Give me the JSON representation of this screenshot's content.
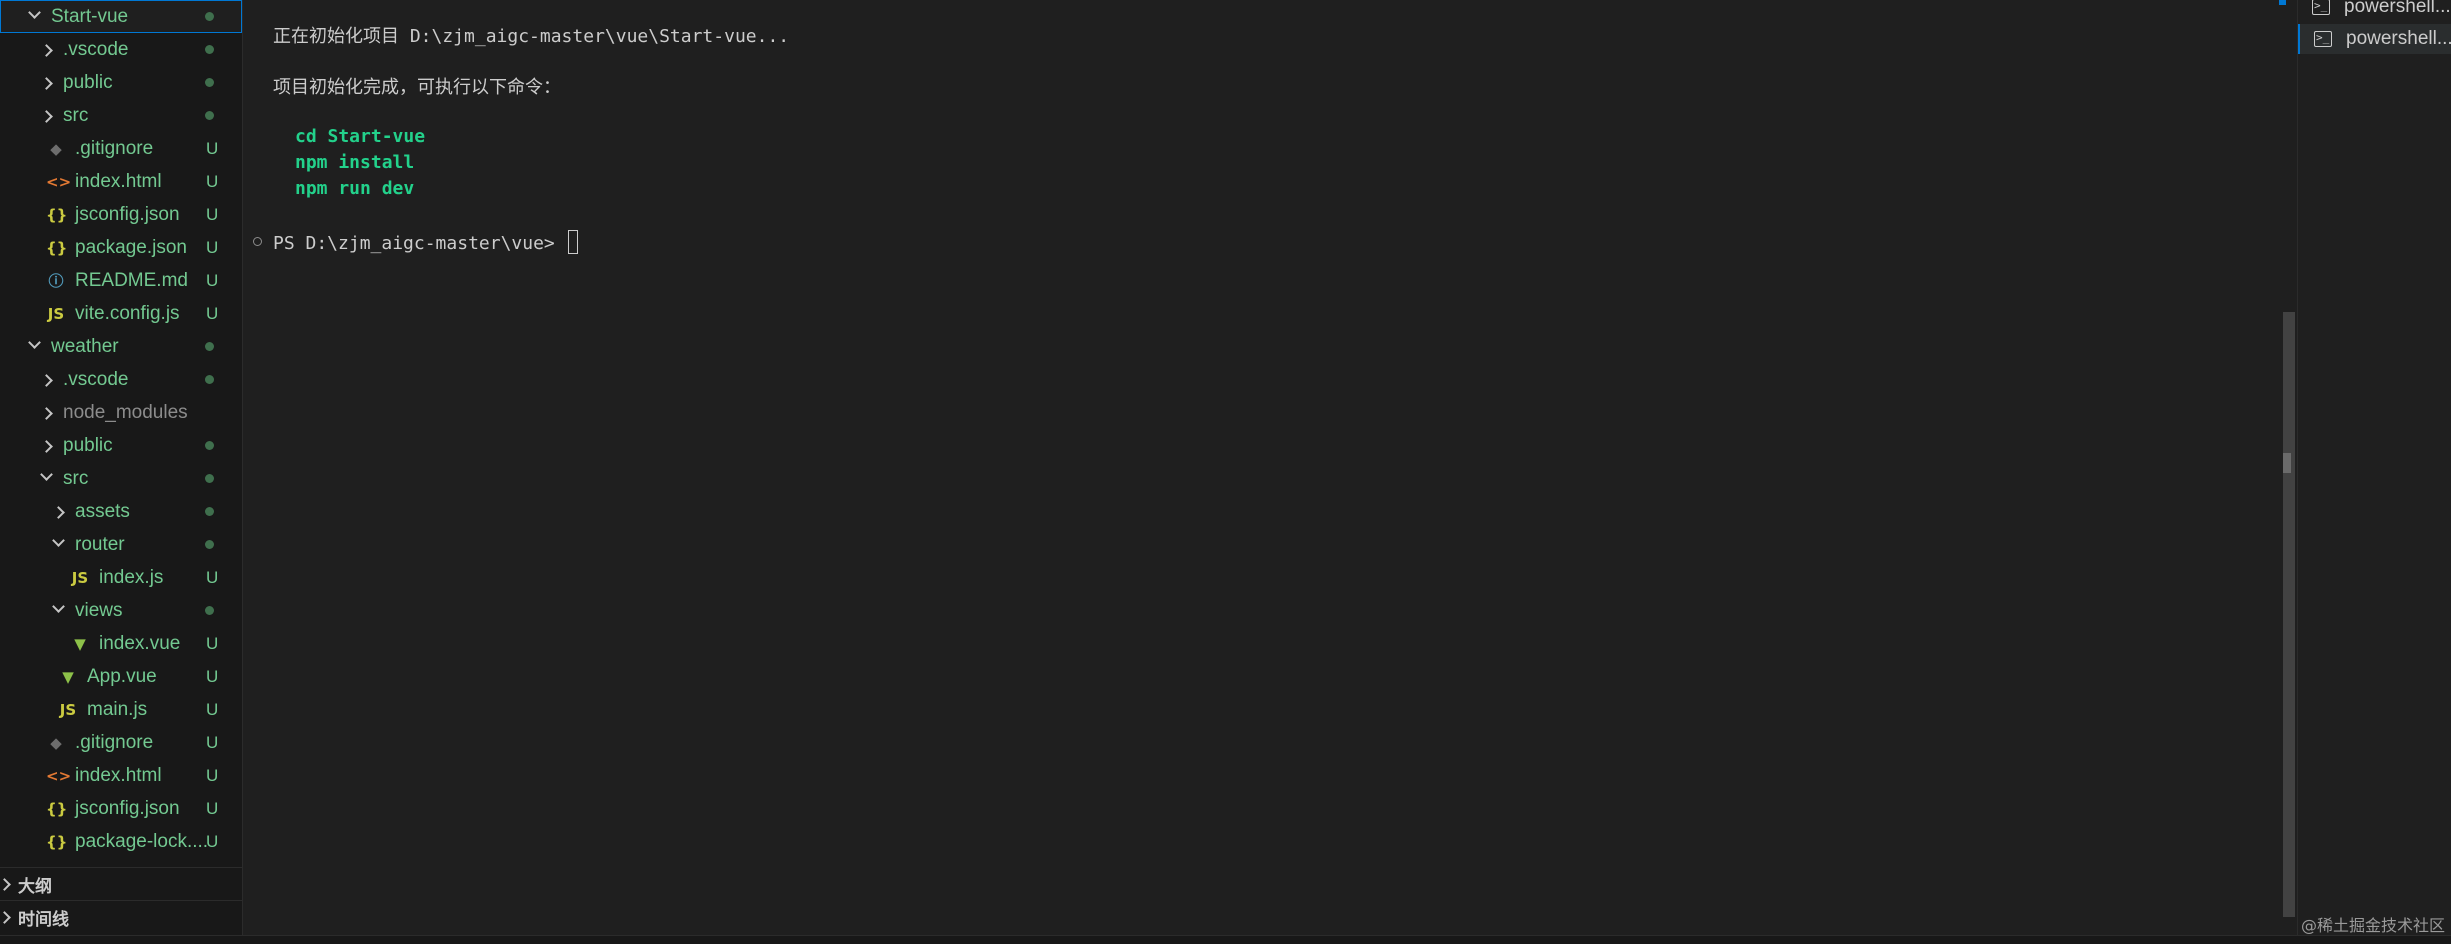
{
  "explorer": {
    "items": [
      {
        "label": "Start-vue",
        "kind": "folder-open",
        "depth": 0,
        "status": "dot",
        "color": "green",
        "selected": true
      },
      {
        "label": ".vscode",
        "kind": "folder-closed",
        "depth": 1,
        "status": "dot",
        "color": "green"
      },
      {
        "label": "public",
        "kind": "folder-closed",
        "depth": 1,
        "status": "dot",
        "color": "green"
      },
      {
        "label": "src",
        "kind": "folder-closed",
        "depth": 1,
        "status": "dot",
        "color": "green"
      },
      {
        "label": ".gitignore",
        "kind": "file",
        "icon": "git",
        "depth": 1,
        "status": "U",
        "color": "green"
      },
      {
        "label": "index.html",
        "kind": "file",
        "icon": "html",
        "depth": 1,
        "status": "U",
        "color": "green"
      },
      {
        "label": "jsconfig.json",
        "kind": "file",
        "icon": "json",
        "depth": 1,
        "status": "U",
        "color": "green"
      },
      {
        "label": "package.json",
        "kind": "file",
        "icon": "json",
        "depth": 1,
        "status": "U",
        "color": "green"
      },
      {
        "label": "README.md",
        "kind": "file",
        "icon": "info",
        "depth": 1,
        "status": "U",
        "color": "green"
      },
      {
        "label": "vite.config.js",
        "kind": "file",
        "icon": "js",
        "depth": 1,
        "status": "U",
        "color": "green"
      },
      {
        "label": "weather",
        "kind": "folder-open",
        "depth": 0,
        "status": "dot",
        "color": "green"
      },
      {
        "label": ".vscode",
        "kind": "folder-closed",
        "depth": 1,
        "status": "dot",
        "color": "green"
      },
      {
        "label": "node_modules",
        "kind": "folder-closed",
        "depth": 1,
        "status": "",
        "color": "gray"
      },
      {
        "label": "public",
        "kind": "folder-closed",
        "depth": 1,
        "status": "dot",
        "color": "green"
      },
      {
        "label": "src",
        "kind": "folder-open",
        "depth": 1,
        "status": "dot",
        "color": "green"
      },
      {
        "label": "assets",
        "kind": "folder-closed",
        "depth": 2,
        "status": "dot",
        "color": "green"
      },
      {
        "label": "router",
        "kind": "folder-open",
        "depth": 2,
        "status": "dot",
        "color": "green"
      },
      {
        "label": "index.js",
        "kind": "file",
        "icon": "js",
        "depth": 3,
        "status": "U",
        "color": "green"
      },
      {
        "label": "views",
        "kind": "folder-open",
        "depth": 2,
        "status": "dot",
        "color": "green"
      },
      {
        "label": "index.vue",
        "kind": "file",
        "icon": "vue",
        "depth": 3,
        "status": "U",
        "color": "green"
      },
      {
        "label": "App.vue",
        "kind": "file",
        "icon": "vue",
        "depth": 2,
        "status": "U",
        "color": "green"
      },
      {
        "label": "main.js",
        "kind": "file",
        "icon": "js",
        "depth": 2,
        "status": "U",
        "color": "green"
      },
      {
        "label": ".gitignore",
        "kind": "file",
        "icon": "git",
        "depth": 1,
        "status": "U",
        "color": "green"
      },
      {
        "label": "index.html",
        "kind": "file",
        "icon": "html",
        "depth": 1,
        "status": "U",
        "color": "green"
      },
      {
        "label": "jsconfig.json",
        "kind": "file",
        "icon": "json",
        "depth": 1,
        "status": "U",
        "color": "green"
      },
      {
        "label": "package-lock....",
        "kind": "file",
        "icon": "json",
        "depth": 1,
        "status": "U",
        "color": "green"
      }
    ],
    "sections": [
      {
        "label": "大纲"
      },
      {
        "label": "时间线"
      }
    ]
  },
  "icons": {
    "git": {
      "glyph": "◆",
      "color": "#6d6d6d"
    },
    "html": {
      "glyph": "<>",
      "color": "#e37933"
    },
    "json": {
      "glyph": "{}",
      "color": "#cbcb41"
    },
    "info": {
      "glyph": "ⓘ",
      "color": "#519aba"
    },
    "js": {
      "glyph": "JS",
      "color": "#cbcb41"
    },
    "vue": {
      "glyph": "▼",
      "color": "#8dc149"
    }
  },
  "terminal": {
    "line1": "正在初始化项目 D:\\zjm_aigc-master\\vue\\Start-vue...",
    "line2": "项目初始化完成，可执行以下命令：",
    "cmd1": "cd Start-vue",
    "cmd2": "npm install",
    "cmd3": "npm run dev",
    "prompt": "PS D:\\zjm_aigc-master\\vue> "
  },
  "terminal_tabs": [
    {
      "label": "powershell...",
      "active": false
    },
    {
      "label": "powershell...",
      "active": true
    }
  ],
  "watermark": "@稀土掘金技术社区",
  "colors": {
    "accent": "#0078d4",
    "untracked_green": "#73c991",
    "command_green": "#23d18b"
  }
}
